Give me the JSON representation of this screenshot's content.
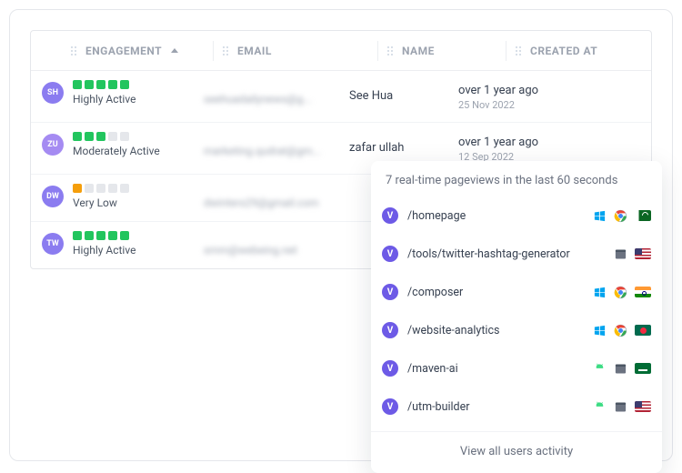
{
  "columns": {
    "engagement": "ENGAGEMENT",
    "email": "EMAIL",
    "name": "NAME",
    "created": "CREATED AT"
  },
  "rows": [
    {
      "initials": "SH",
      "avatar_color": "#8b7cf0",
      "bars": [
        "g",
        "g",
        "g",
        "g",
        "g"
      ],
      "label": "Highly Active",
      "email": "seehuadailynews@g...",
      "name": "See Hua",
      "created_rel": "over 1 year ago",
      "created_date": "25 Nov 2022"
    },
    {
      "initials": "ZU",
      "avatar_color": "#a58bf2",
      "bars": [
        "g",
        "g",
        "g",
        "e",
        "e"
      ],
      "label": "Moderately Active",
      "email": "marketing.qudrat@gm...",
      "name": "zafar ullah",
      "created_rel": "over 1 year ago",
      "created_date": "12 Sep 2022"
    },
    {
      "initials": "DW",
      "avatar_color": "#8b7cf0",
      "bars": [
        "o",
        "e",
        "e",
        "e",
        "e"
      ],
      "label": "Very Low",
      "email": "dwinters29@gmail.com",
      "name": "",
      "created_rel": "",
      "created_date": ""
    },
    {
      "initials": "TW",
      "avatar_color": "#8b7cf0",
      "bars": [
        "g",
        "g",
        "g",
        "g",
        "g"
      ],
      "label": "Highly Active",
      "email": "smm@webeing.net",
      "name": "",
      "created_rel": "",
      "created_date": ""
    }
  ],
  "popover": {
    "title": "7 real-time pageviews in the last 60 seconds",
    "dot_label": "V",
    "items": [
      {
        "path": "/homepage",
        "icons": [
          "windows",
          "chrome"
        ],
        "flag": "pk"
      },
      {
        "path": "/tools/twitter-hashtag-generator",
        "icons": [
          "browser"
        ],
        "flag": "us"
      },
      {
        "path": "/composer",
        "icons": [
          "windows",
          "chrome"
        ],
        "flag": "in"
      },
      {
        "path": "/website-analytics",
        "icons": [
          "windows",
          "chrome"
        ],
        "flag": "bd"
      },
      {
        "path": "/maven-ai",
        "icons": [
          "android",
          "browser"
        ],
        "flag": "sa"
      },
      {
        "path": "/utm-builder",
        "icons": [
          "android",
          "browser"
        ],
        "flag": "us"
      }
    ],
    "footer": "View all users activity"
  }
}
